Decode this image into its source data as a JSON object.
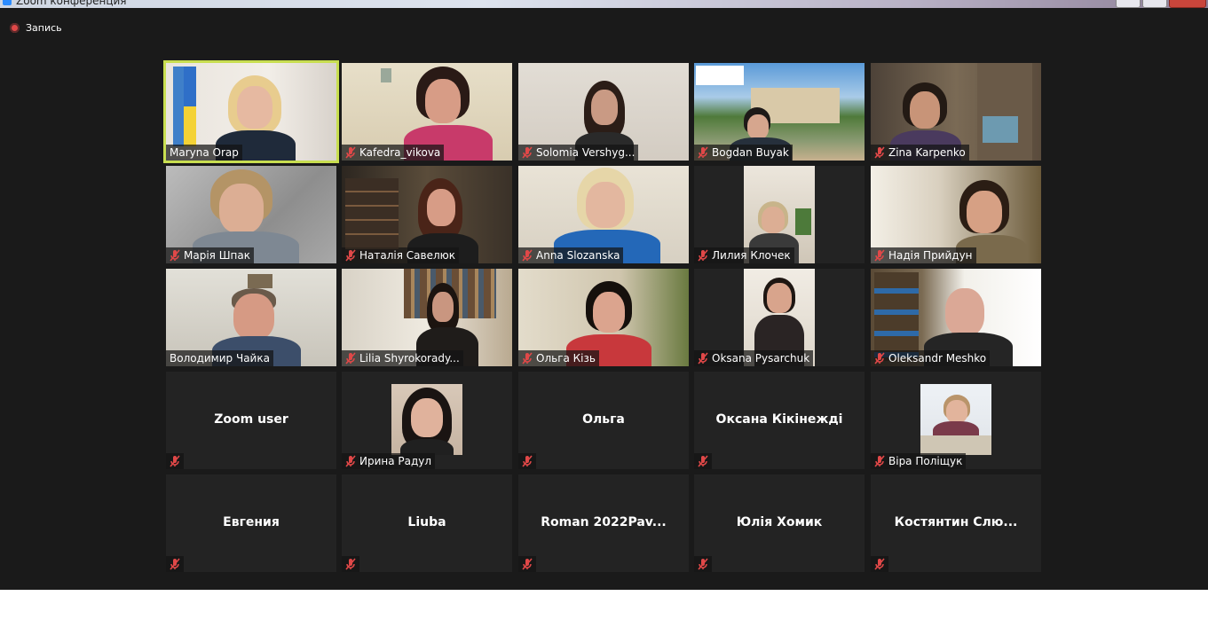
{
  "window": {
    "title": "Zoom конференция"
  },
  "recording": {
    "label": "Запись"
  },
  "participants": [
    {
      "name": "Maryna Orap",
      "muted": false
    },
    {
      "name": "Kafedra_vikova",
      "muted": true
    },
    {
      "name": "Solomia Vershyg...",
      "muted": true
    },
    {
      "name": "Bogdan Buyak",
      "muted": true
    },
    {
      "name": "Zina Karpenko",
      "muted": true
    },
    {
      "name": "Марія Шпак",
      "muted": true
    },
    {
      "name": "Наталія Савелюк",
      "muted": true
    },
    {
      "name": "Anna Slozanska",
      "muted": true
    },
    {
      "name": "Лилия Клочек",
      "muted": true
    },
    {
      "name": "Надія Прийдун",
      "muted": true
    },
    {
      "name": "Володимир Чайка",
      "muted": false
    },
    {
      "name": "Lilia Shyrokorady...",
      "muted": true
    },
    {
      "name": "Ольга Кізь",
      "muted": true
    },
    {
      "name": "Oksana Pysarchuk",
      "muted": true
    },
    {
      "name": "Oleksandr Meshko",
      "muted": true
    },
    {
      "name": "Zoom user",
      "muted": true
    },
    {
      "name": "Ирина Радул",
      "muted": true
    },
    {
      "name": "Ольга",
      "muted": true
    },
    {
      "name": "Оксана Кікінежді",
      "muted": true
    },
    {
      "name": "Віра Поліщук",
      "muted": true
    },
    {
      "name": "Евгения",
      "muted": true
    },
    {
      "name": "Liuba",
      "muted": true
    },
    {
      "name": "Roman  2022Pav...",
      "muted": true
    },
    {
      "name": "Юлія Хомик",
      "muted": true
    },
    {
      "name": "Костянтин  Слю...",
      "muted": true
    }
  ],
  "colors": {
    "background": "#1a1a1a",
    "tile": "#232323",
    "active_speaker": "#c8de50",
    "mute_icon": "#e04848"
  }
}
